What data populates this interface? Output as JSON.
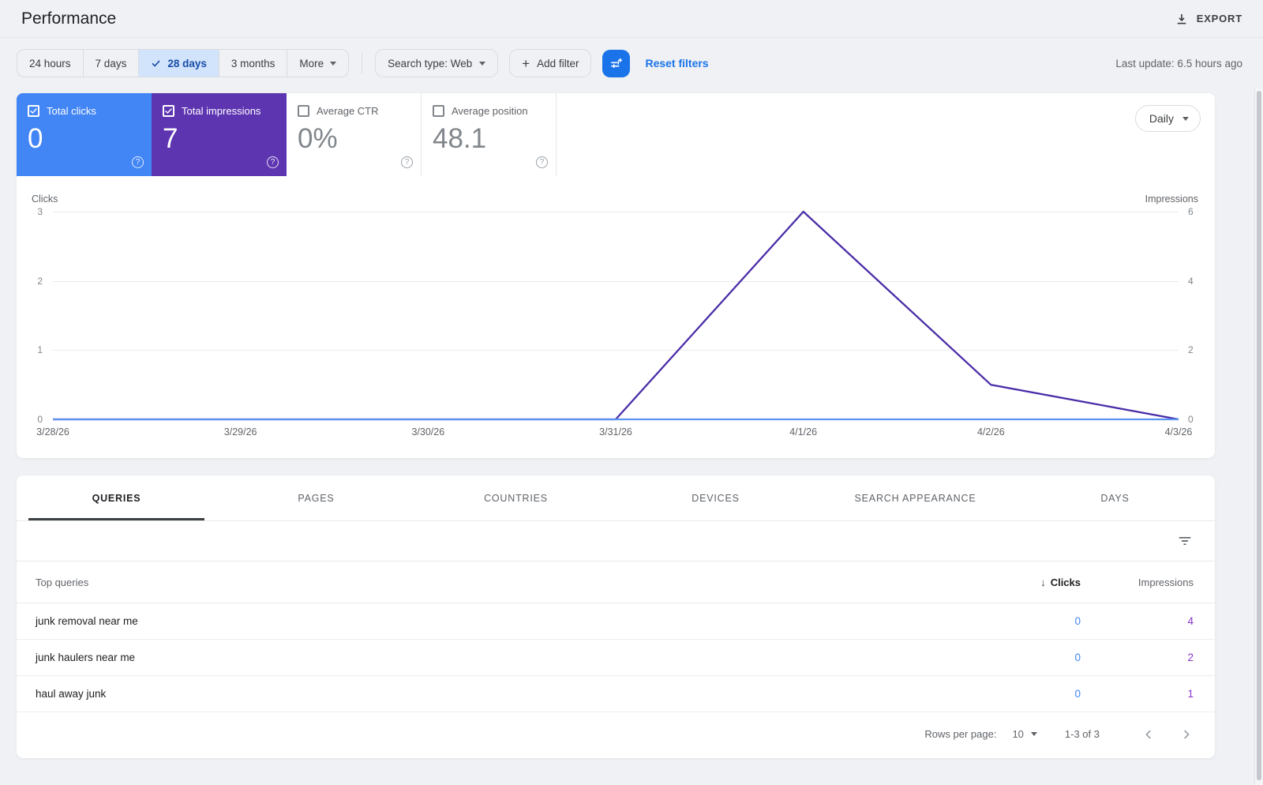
{
  "header": {
    "title": "Performance",
    "export_label": "EXPORT"
  },
  "filters": {
    "date_ranges": [
      "24 hours",
      "7 days",
      "28 days",
      "3 months"
    ],
    "selected_range": "28 days",
    "more_label": "More",
    "search_type_label": "Search type: Web",
    "add_filter_label": "Add filter",
    "reset_label": "Reset filters",
    "last_update": "Last update: 6.5 hours ago"
  },
  "metrics": {
    "granularity": "Daily",
    "cards": [
      {
        "label": "Total clicks",
        "value": "0",
        "selected": true,
        "color": "#4285f4"
      },
      {
        "label": "Total impressions",
        "value": "7",
        "selected": true,
        "color": "#5e35b1"
      },
      {
        "label": "Average CTR",
        "value": "0%",
        "selected": false
      },
      {
        "label": "Average position",
        "value": "48.1",
        "selected": false
      }
    ]
  },
  "chart_data": {
    "type": "line",
    "x": [
      "3/28/26",
      "3/29/26",
      "3/30/26",
      "3/31/26",
      "4/1/26",
      "4/2/26",
      "4/3/26"
    ],
    "series": [
      {
        "name": "Clicks",
        "axis": "left",
        "color": "#5b93f2",
        "values": [
          0,
          0,
          0,
          0,
          0,
          0,
          0
        ]
      },
      {
        "name": "Impressions",
        "axis": "right",
        "color": "#4b2da8",
        "values": [
          0,
          0,
          0,
          0,
          6,
          1,
          0
        ]
      }
    ],
    "left_axis": {
      "label": "Clicks",
      "ticks": [
        3,
        2,
        1,
        0
      ],
      "max": 3
    },
    "right_axis": {
      "label": "Impressions",
      "ticks": [
        6,
        4,
        2,
        0
      ],
      "max": 6
    },
    "grid": true,
    "legend_position": "none"
  },
  "tabs": {
    "active": "QUERIES",
    "items": [
      "QUERIES",
      "PAGES",
      "COUNTRIES",
      "DEVICES",
      "SEARCH APPEARANCE",
      "DAYS"
    ]
  },
  "table": {
    "columns": [
      "Top queries",
      "Clicks",
      "Impressions"
    ],
    "sort_column": "Clicks",
    "rows": [
      {
        "query": "junk removal near me",
        "clicks": "0",
        "impressions": "4"
      },
      {
        "query": "junk haulers near me",
        "clicks": "0",
        "impressions": "2"
      },
      {
        "query": "haul away junk",
        "clicks": "0",
        "impressions": "1"
      }
    ]
  },
  "pagination": {
    "rows_per_page_label": "Rows per page:",
    "rows_per_page": "10",
    "range": "1-3 of 3"
  },
  "colors": {
    "accent_blue": "#1a73e8",
    "clicks_blue": "#4285f4",
    "impressions_purple": "#5e35b1",
    "table_clicks": "#4285f4",
    "table_impressions": "#8633c8",
    "chip_selected_bg": "#d2e3fc",
    "chip_selected_text": "#174ea6"
  }
}
